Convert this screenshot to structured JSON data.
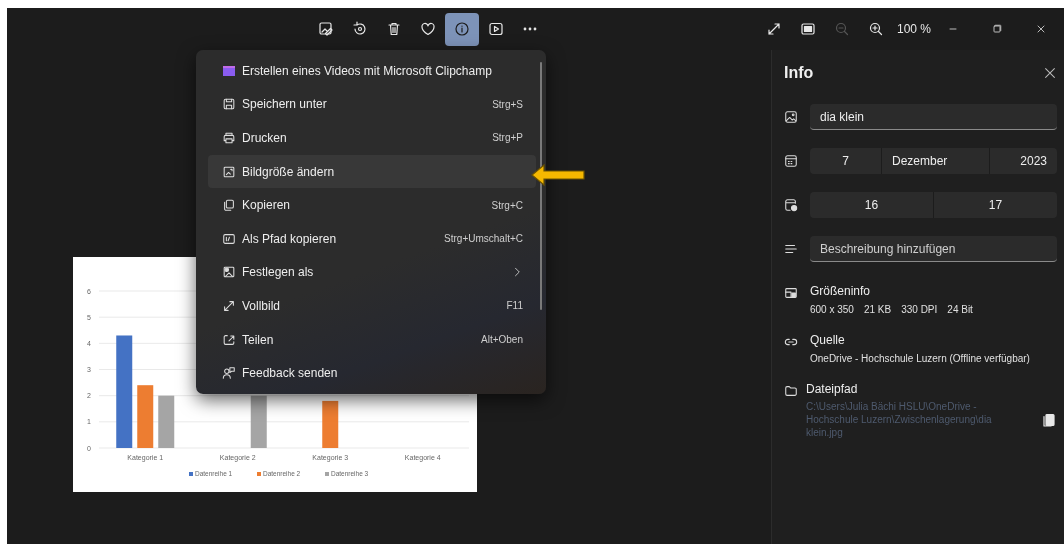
{
  "toolbar": [
    {
      "kind": "edit",
      "selected": false
    },
    {
      "kind": "rotate",
      "selected": false
    },
    {
      "kind": "delete",
      "selected": false
    },
    {
      "kind": "favorite",
      "selected": false
    },
    {
      "kind": "info",
      "selected": true
    },
    {
      "kind": "slideshow",
      "selected": false
    },
    {
      "kind": "more",
      "selected": false
    }
  ],
  "view_controls": [
    {
      "kind": "fullscreen",
      "disabled": false
    },
    {
      "kind": "fit",
      "disabled": false
    },
    {
      "kind": "zoom-out",
      "disabled": true
    },
    {
      "kind": "zoom-in",
      "disabled": false
    }
  ],
  "zoom_text": "100 %",
  "image": {
    "chart_data": {
      "type": "bar",
      "categories": [
        "Kategorie 1",
        "Kategorie 2",
        "Kategorie 3",
        "Kategorie 4"
      ],
      "series": [
        {
          "name": "Datenreihe 1",
          "color": "#4472c4",
          "values": [
            4.3,
            null,
            null,
            null
          ]
        },
        {
          "name": "Datenreihe 2",
          "color": "#ed7d31",
          "values": [
            2.4,
            null,
            1.8,
            null
          ]
        },
        {
          "name": "Datenreihe 3",
          "color": "#a5a5a5",
          "values": [
            2,
            2,
            null,
            null
          ]
        }
      ],
      "ylim": [
        0,
        6
      ],
      "yticks": [
        0,
        1,
        2,
        3,
        4,
        5,
        6
      ],
      "grid": true,
      "legend": "bottom"
    }
  },
  "menu": {
    "items": [
      {
        "kind": "clipchamp",
        "label": "Erstellen eines Videos mit Microsoft Clipchamp",
        "highlighted": false
      },
      {
        "kind": "save",
        "label": "Speichern unter",
        "shortcut": "Strg+S",
        "highlighted": false
      },
      {
        "kind": "print",
        "label": "Drucken",
        "shortcut": "Strg+P",
        "highlighted": false
      },
      {
        "kind": "resize",
        "label": "Bildgröße ändern",
        "highlighted": true
      },
      {
        "kind": "copy",
        "label": "Kopieren",
        "shortcut": "Strg+C",
        "highlighted": false
      },
      {
        "kind": "copy-path",
        "label": "Als Pfad kopieren",
        "shortcut": "Strg+Umschalt+C",
        "highlighted": false
      },
      {
        "kind": "set-as",
        "label": "Festlegen als",
        "submenu": true,
        "highlighted": false
      },
      {
        "kind": "fullscreen",
        "label": "Vollbild",
        "shortcut": "F11",
        "highlighted": false
      },
      {
        "kind": "share",
        "label": "Teilen",
        "shortcut": "Alt+Oben",
        "highlighted": false
      },
      {
        "kind": "feedback",
        "label": "Feedback senden",
        "highlighted": false
      }
    ]
  },
  "info": {
    "title": "Info",
    "name": "dia klein",
    "date": [
      "7",
      "Dezember",
      "2023"
    ],
    "time": [
      "16",
      "17"
    ],
    "description_placeholder": "Beschreibung hinzufügen",
    "sections": [
      {
        "kind": "size",
        "title": "Größeninfo",
        "values": [
          "600 x 350",
          "21 KB",
          "330 DPI",
          "24 Bit"
        ]
      },
      {
        "kind": "source",
        "title": "Quelle",
        "values": [
          "OneDrive - Hochschule Luzern (Offline verfügbar)"
        ]
      },
      {
        "kind": "path",
        "title": "Dateipfad",
        "values": [
          "C:\\Users\\Julia Bächi HSLU\\OneDrive - Hochschule Luzern\\Zwischenlagerung\\dia klein.jpg"
        ],
        "copy": true
      }
    ]
  }
}
